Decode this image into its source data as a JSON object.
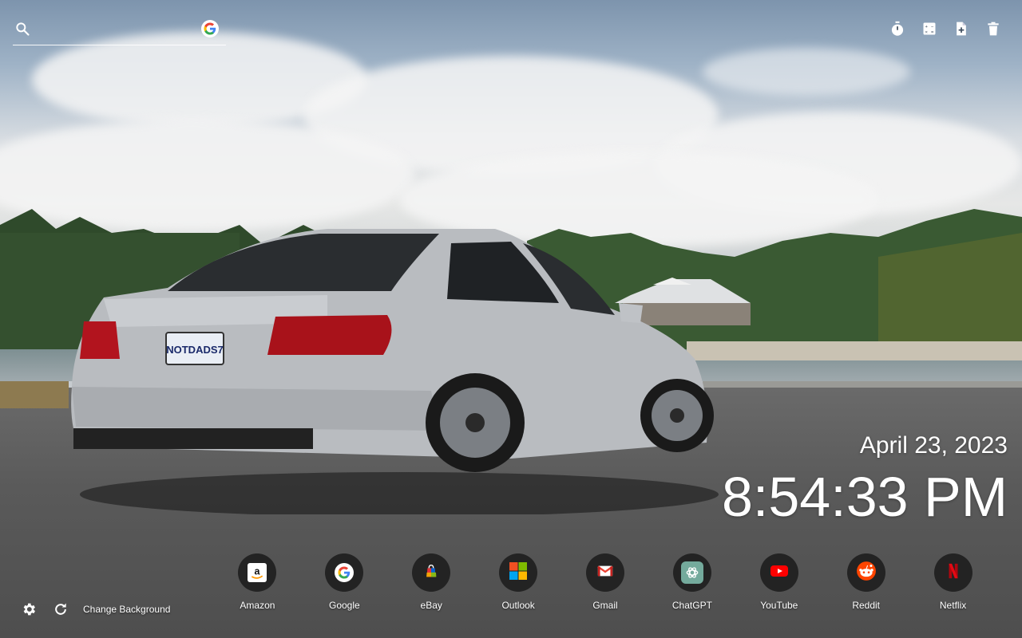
{
  "search": {
    "placeholder": "",
    "value": ""
  },
  "toolbar": {
    "icons": [
      "timer-icon",
      "calculator-icon",
      "new-note-icon",
      "trash-icon"
    ]
  },
  "clock": {
    "date": "April 23, 2023",
    "time": "8:54:33 PM"
  },
  "shortcuts": [
    {
      "label": "Amazon",
      "icon": "amazon-icon"
    },
    {
      "label": "Google",
      "icon": "google-icon"
    },
    {
      "label": "eBay",
      "icon": "ebay-icon"
    },
    {
      "label": "Outlook",
      "icon": "outlook-icon"
    },
    {
      "label": "Gmail",
      "icon": "gmail-icon"
    },
    {
      "label": "ChatGPT",
      "icon": "chatgpt-icon"
    },
    {
      "label": "YouTube",
      "icon": "youtube-icon"
    },
    {
      "label": "Reddit",
      "icon": "reddit-icon"
    },
    {
      "label": "Netflix",
      "icon": "netflix-icon"
    }
  ],
  "footer": {
    "change_background": "Change Background"
  },
  "background": {
    "scene": "silver-sedan-parking-lot",
    "plate_text": "NOTDADS7"
  },
  "colors": {
    "icon_circle": "#232323",
    "text": "#ffffff"
  }
}
